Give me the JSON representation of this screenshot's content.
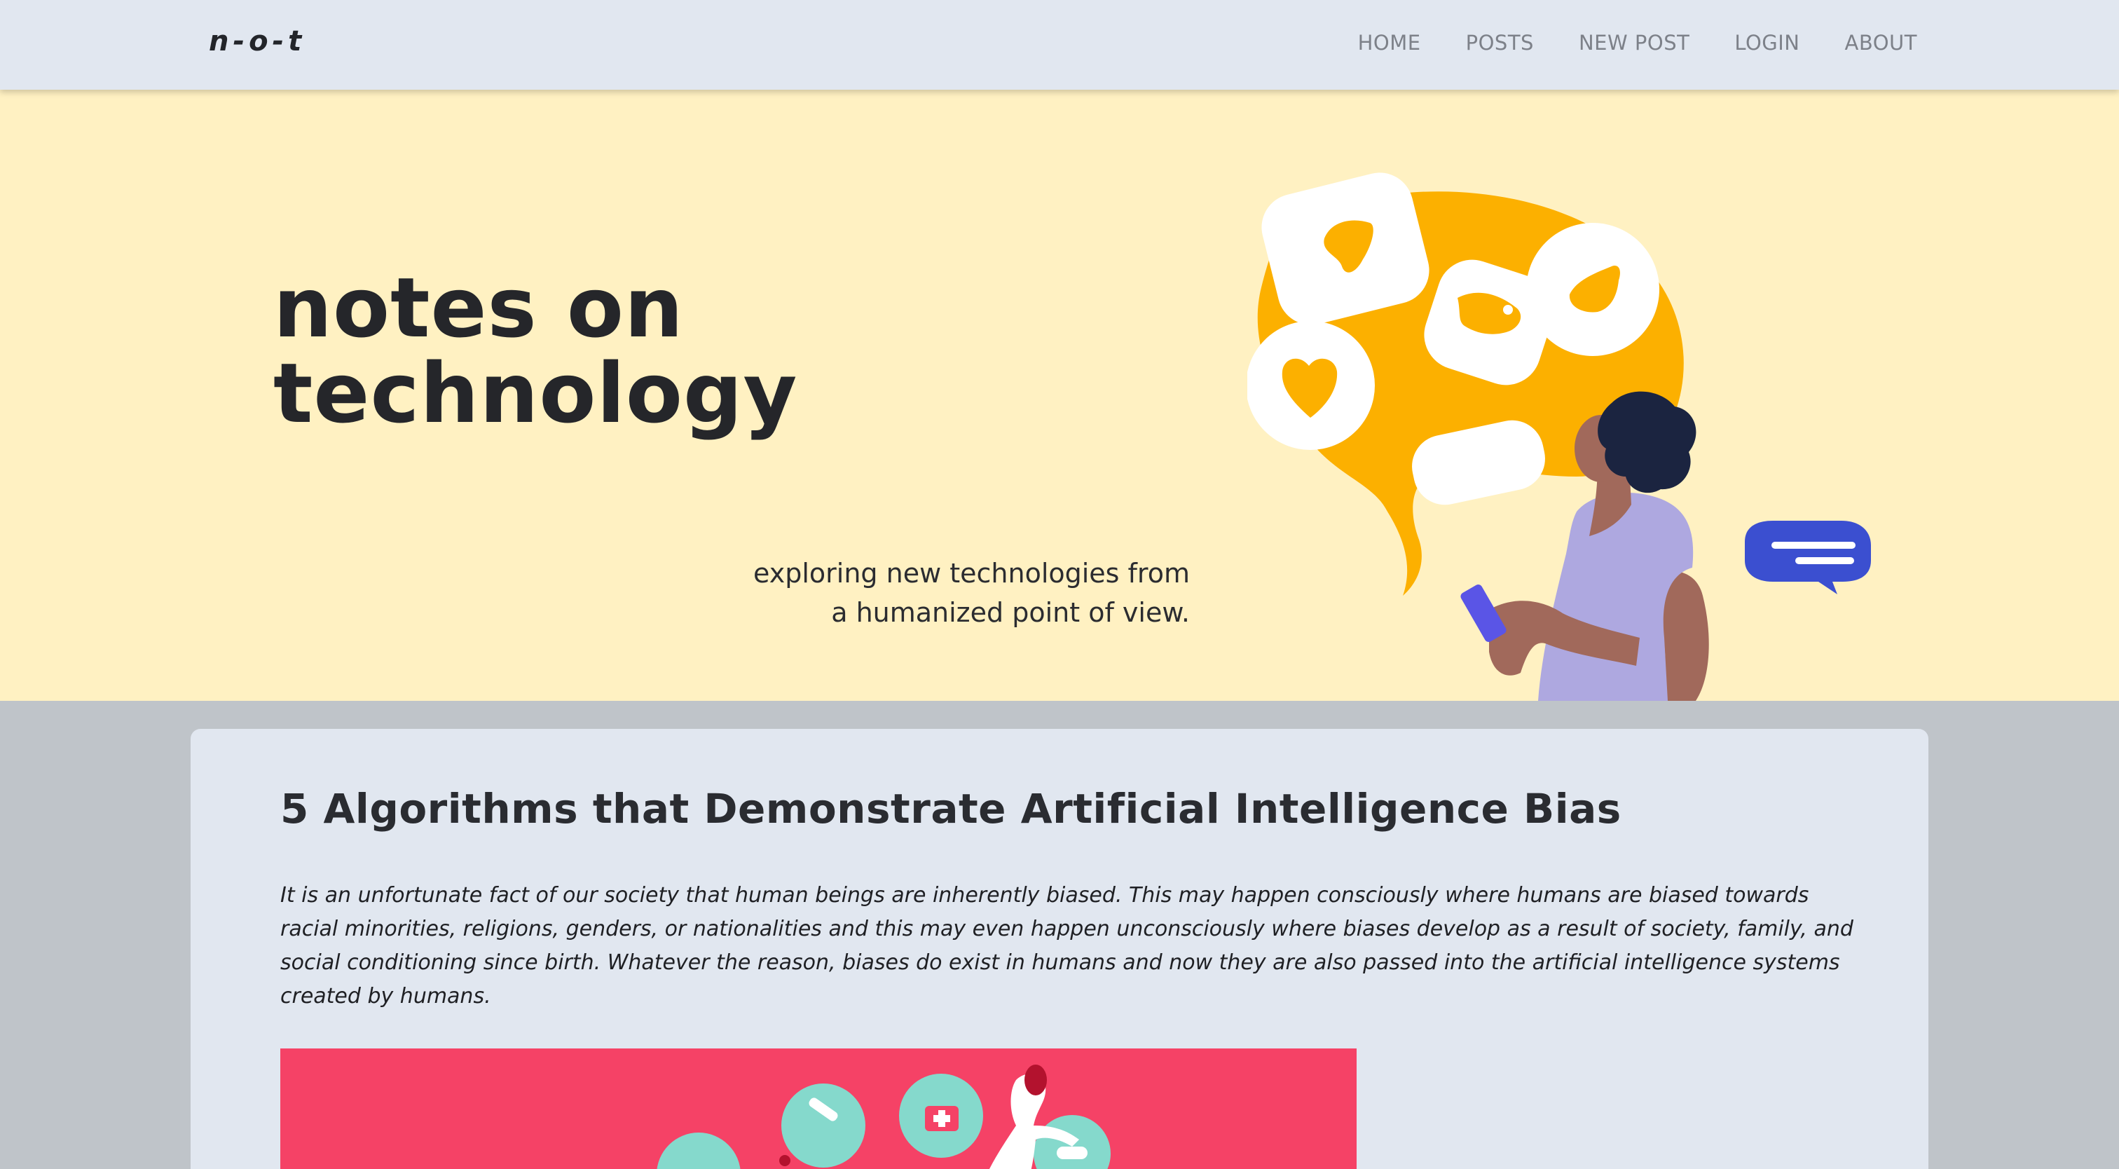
{
  "navbar": {
    "brand": "n-o-t",
    "links": [
      {
        "label": "HOME"
      },
      {
        "label": "POSTS"
      },
      {
        "label": "NEW POST"
      },
      {
        "label": "LOGIN"
      },
      {
        "label": "ABOUT"
      }
    ]
  },
  "hero": {
    "title_line1": "notes on",
    "title_line2": "technology",
    "subtitle_line1": "exploring new technologies from",
    "subtitle_line2": "a humanized point of view."
  },
  "post": {
    "title": "5 Algorithms that Demonstrate Artificial Intelligence Bias",
    "excerpt": "It is an unfortunate fact of our society that human beings are inherently biased. This may happen consciously where humans are biased towards racial minorities, religions, genders, or nationalities and this may even happen unconsciously where biases develop as a result of society, family, and social conditioning since birth. Whatever the reason, biases do exist in humans and now they are also passed into the artificial intelligence systems created by humans."
  },
  "colors": {
    "navbar_bg": "#e1e7f0",
    "hero_bg": "#fff1c2",
    "page_bg": "#bfc4c9",
    "card_bg": "#e1e7f0",
    "accent_orange": "#fcb000",
    "chat_blue": "#3b4fd0",
    "post_image_bg": "#f54266"
  }
}
